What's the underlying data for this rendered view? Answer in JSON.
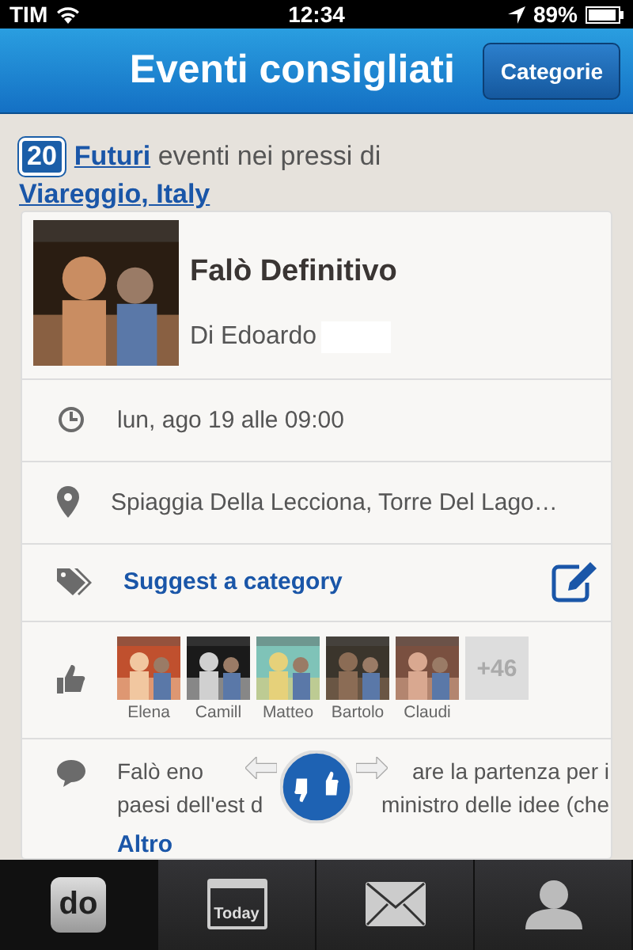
{
  "status_bar": {
    "carrier": "TIM",
    "time": "12:34",
    "battery": "89%"
  },
  "nav": {
    "title": "Eventi consigliati",
    "button": "Categorie"
  },
  "summary": {
    "count": "20",
    "filter": "Futuri",
    "text": "eventi nei pressi di",
    "location": "Viareggio, Italy"
  },
  "event": {
    "title": "Falò Definitivo",
    "author": "Di Edoardo",
    "details": [
      {
        "kind": "time",
        "text": "lun, ago 19 alle 09:00"
      },
      {
        "kind": "place",
        "text": "Spiaggia Della Lecciona, Torre Del Lago…"
      },
      {
        "kind": "category",
        "text": "Suggest a category"
      }
    ],
    "likes": [
      {
        "name": "Elena"
      },
      {
        "name": "Camill"
      },
      {
        "name": "Matteo"
      },
      {
        "name": "Bartolo"
      },
      {
        "name": "Claudi"
      }
    ],
    "more_likes": "+46",
    "description": [
      {
        "left": "Falò eno",
        "right": "are la partenza per i"
      },
      {
        "left": "paesi dell'est d",
        "right": "ministro delle idee (che"
      }
    ],
    "more": "Altro"
  },
  "tabs": [
    {
      "kind": "do",
      "label": "do",
      "selected": true
    },
    {
      "kind": "calendar",
      "label": "Today",
      "selected": false
    },
    {
      "kind": "mail",
      "selected": false
    },
    {
      "kind": "profile",
      "selected": false
    }
  ]
}
